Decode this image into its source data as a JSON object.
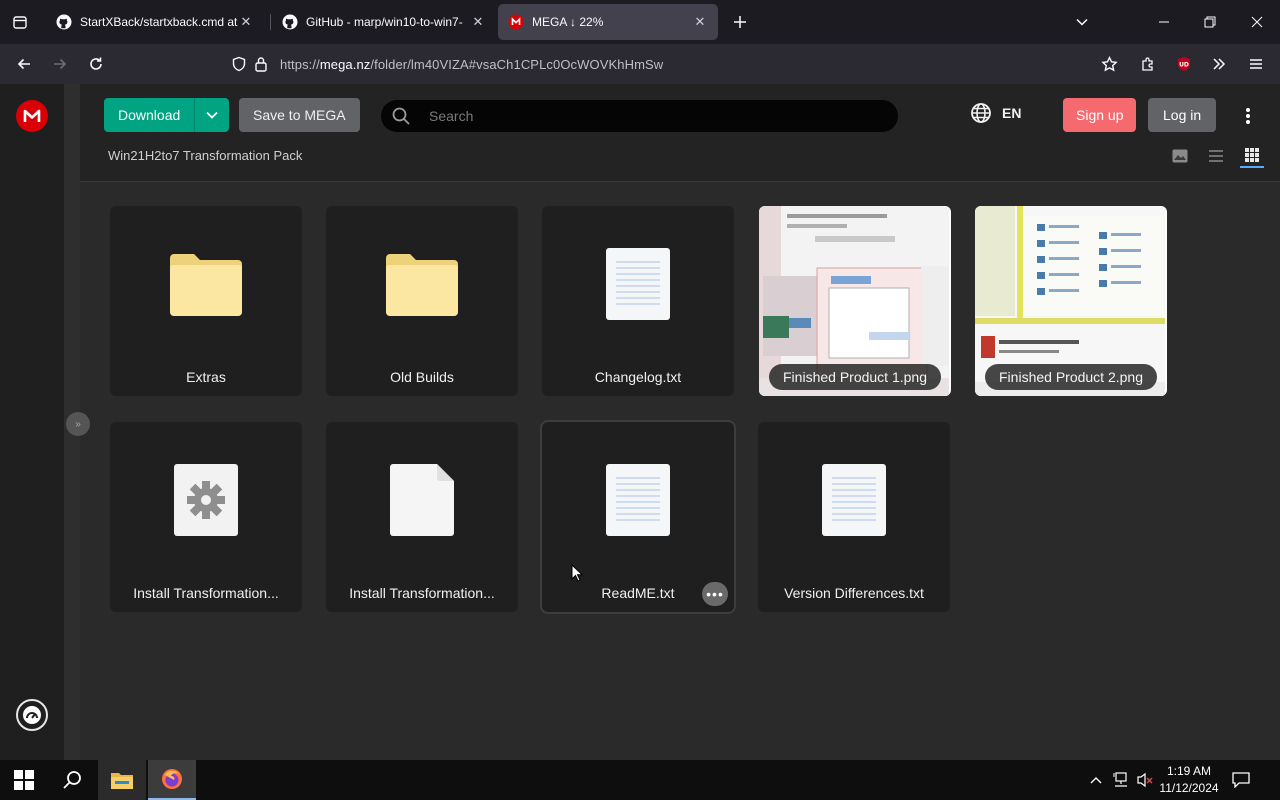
{
  "browser": {
    "tabs": [
      {
        "title": "StartXBack/startxback.cmd at m",
        "favicon": "github-icon",
        "active": false
      },
      {
        "title": "GitHub - marp/win10-to-win7-",
        "favicon": "github-icon",
        "active": false
      },
      {
        "title": "MEGA ↓ 22%",
        "favicon": "mega-icon",
        "active": true
      }
    ],
    "url_prefix": "https://",
    "url_domain": "mega.nz",
    "url_path": "/folder/lm40VIZA#vsaCh1CPLc0OcWOVKhHmSw"
  },
  "mega": {
    "download_label": "Download",
    "save_label": "Save to MEGA",
    "search_placeholder": "Search",
    "language": "EN",
    "signup_label": "Sign up",
    "login_label": "Log in",
    "breadcrumb": "Win21H2to7 Transformation Pack",
    "accent_green": "#00a382",
    "accent_red": "#f46a6f",
    "items": [
      {
        "name": "Extras",
        "type": "folder"
      },
      {
        "name": "Old Builds",
        "type": "folder"
      },
      {
        "name": "Changelog.txt",
        "type": "text"
      },
      {
        "name": "Finished Product 1.png",
        "type": "image"
      },
      {
        "name": "Finished Product 2.png",
        "type": "image"
      },
      {
        "name": "Install Transformation...",
        "type": "settings"
      },
      {
        "name": "Install Transformation...",
        "type": "blank"
      },
      {
        "name": "ReadME.txt",
        "type": "text",
        "selected": true
      },
      {
        "name": "Version Differences.txt",
        "type": "text"
      }
    ]
  },
  "taskbar": {
    "time": "1:19 AM",
    "date": "11/12/2024"
  }
}
